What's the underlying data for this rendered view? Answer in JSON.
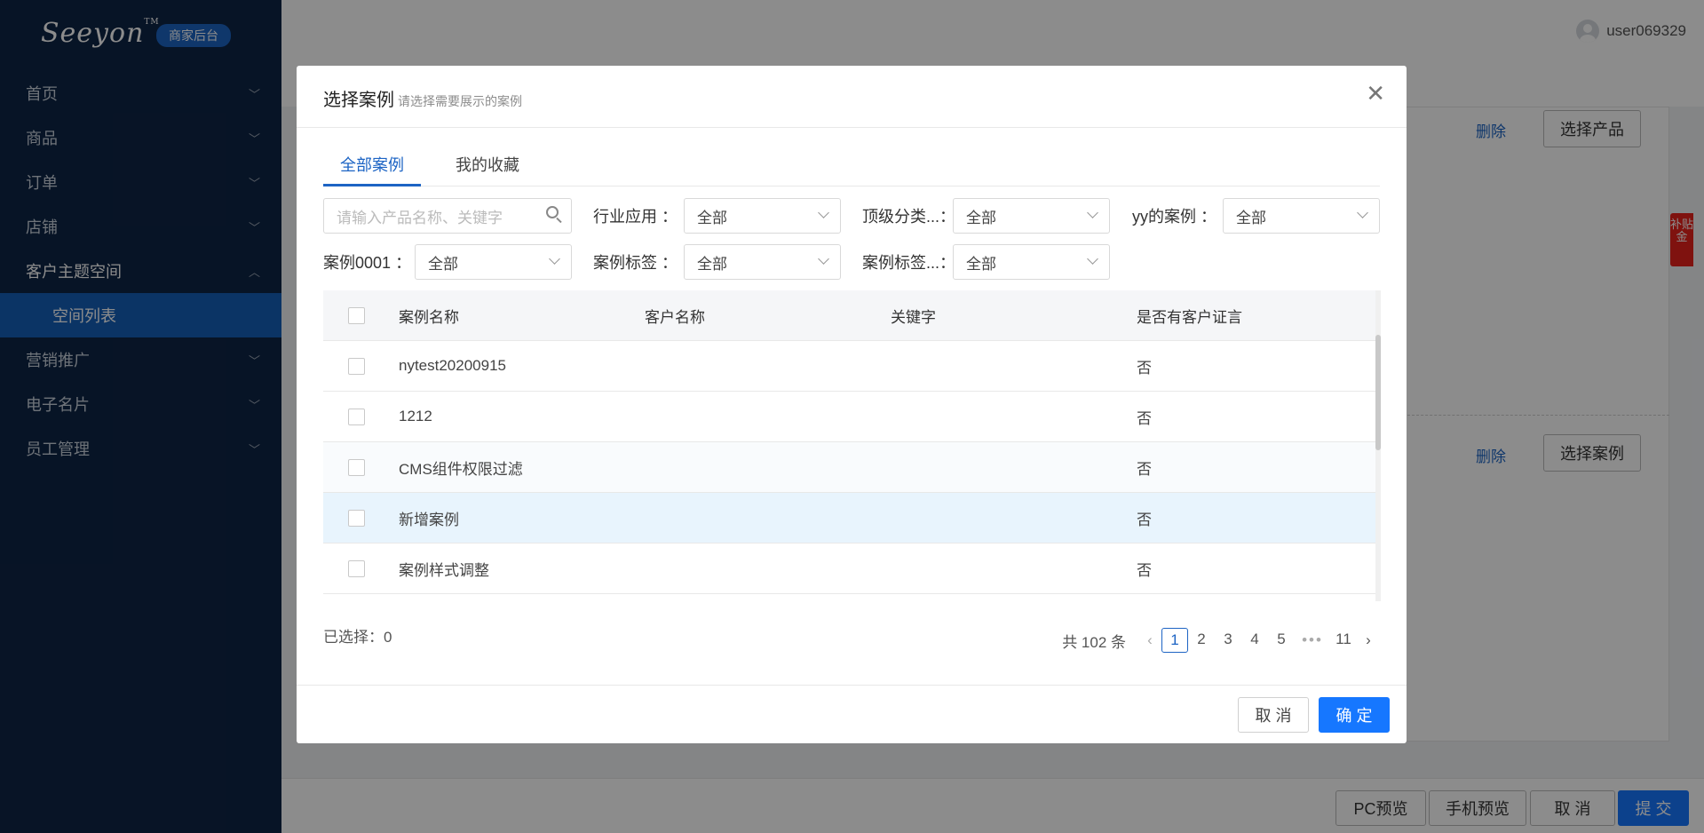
{
  "sidebar": {
    "logo": "Seeyon",
    "logo_tm": "TM",
    "badge": "商家后台",
    "items": [
      {
        "label": "首页"
      },
      {
        "label": "商品"
      },
      {
        "label": "订单"
      },
      {
        "label": "店铺"
      },
      {
        "label": "客户主题空间"
      },
      {
        "label": "空间列表"
      },
      {
        "label": "营销推广"
      },
      {
        "label": "电子名片"
      },
      {
        "label": "员工管理"
      }
    ]
  },
  "header": {
    "username": "user069329"
  },
  "background": {
    "delete_label": "删除",
    "select_product_label": "选择产品",
    "select_case_label": "选择案例",
    "side_tag": "补贴金",
    "footer": {
      "pc_preview": "PC预览",
      "mobile_preview": "手机预览",
      "cancel": "取 消",
      "submit": "提 交"
    }
  },
  "modal": {
    "title": "选择案例",
    "subtitle": "请选择需要展示的案例",
    "tabs": [
      {
        "label": "全部案例"
      },
      {
        "label": "我的收藏"
      }
    ],
    "search_placeholder": "请输入产品名称、关键字",
    "filters": [
      {
        "label": "行业应用",
        "value": "全部"
      },
      {
        "label": "顶级分类...",
        "value": "全部"
      },
      {
        "label": "yy的案例",
        "value": "全部"
      },
      {
        "label": "案例0001",
        "value": "全部"
      },
      {
        "label": "案例标签",
        "value": "全部"
      },
      {
        "label": "案例标签...",
        "value": "全部"
      }
    ],
    "filter_colon": "：",
    "columns": [
      "案例名称",
      "客户名称",
      "关键字",
      "是否有客户证言"
    ],
    "rows": [
      {
        "name": "nytest20200915",
        "customer": "",
        "keyword": "",
        "testimony": "否"
      },
      {
        "name": "1212",
        "customer": "",
        "keyword": "",
        "testimony": "否"
      },
      {
        "name": "CMS组件权限过滤",
        "customer": "",
        "keyword": "",
        "testimony": "否"
      },
      {
        "name": "新增案例",
        "customer": "",
        "keyword": "",
        "testimony": "否"
      },
      {
        "name": "案例样式调整",
        "customer": "",
        "keyword": "",
        "testimony": "否"
      }
    ],
    "selected_text": "已选择：0",
    "pagination": {
      "total": "共 102 条",
      "pages": [
        "1",
        "2",
        "3",
        "4",
        "5"
      ],
      "ellipsis": "•••",
      "last": "11",
      "current": "1"
    },
    "cancel_label": "取 消",
    "ok_label": "确 定"
  }
}
